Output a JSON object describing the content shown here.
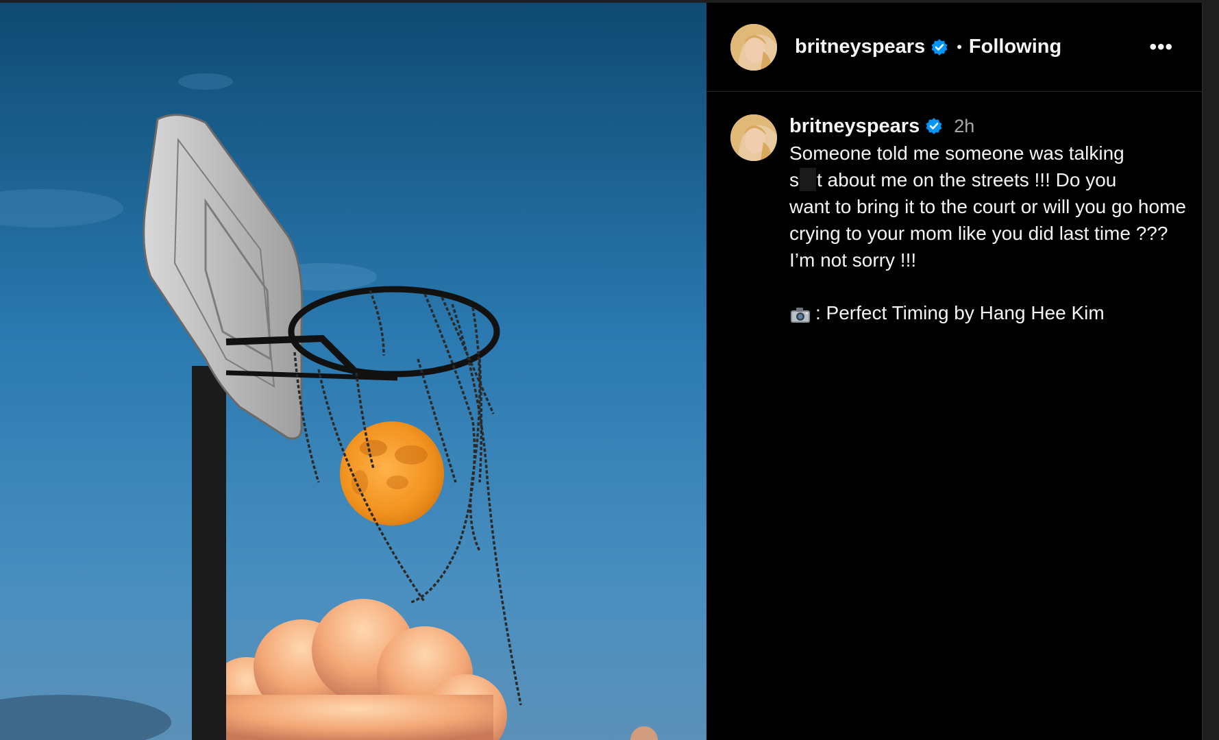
{
  "header": {
    "username": "britneyspears",
    "separator": "•",
    "follow_status": "Following",
    "more_label": "•••"
  },
  "caption": {
    "username": "britneyspears",
    "time": "2h",
    "line1": "Someone told me someone was talking",
    "line2_start": "s",
    "line2_end": "t about me on the streets !!! Do you",
    "rest": "want to bring it to the court or will you go home crying to your mom like you did last time ??? I’m not sorry !!!",
    "credit": ": Perfect Timing by Hang Hee Kim"
  },
  "icons": {
    "verified": "verified-badge-icon",
    "camera": "camera-icon",
    "more": "more-options-icon"
  },
  "colors": {
    "verified": "#0095f6",
    "background": "#000000",
    "text": "#f5f5f5",
    "muted": "#a8a8a8"
  }
}
